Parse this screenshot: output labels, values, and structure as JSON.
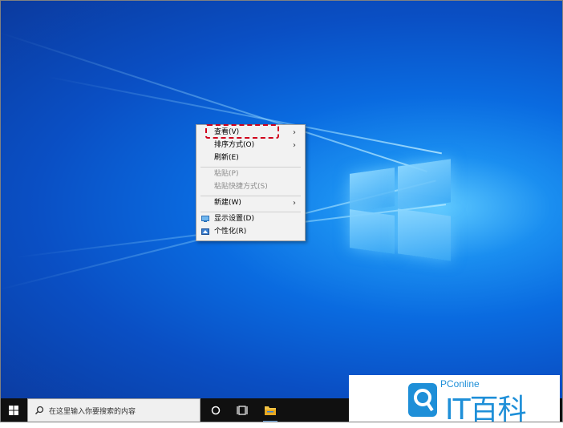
{
  "context_menu": {
    "items": [
      {
        "label": "查看(V)",
        "submenu": true
      },
      {
        "label": "排序方式(O)",
        "submenu": true
      },
      {
        "label": "刷新(E)"
      },
      {
        "label": "粘贴(P)",
        "disabled": true
      },
      {
        "label": "粘贴快捷方式(S)",
        "disabled": true
      },
      {
        "label": "新建(W)",
        "submenu": true
      },
      {
        "label": "显示设置(D)",
        "icon": "display-settings-icon"
      },
      {
        "label": "个性化(R)",
        "icon": "personalize-icon"
      }
    ]
  },
  "taskbar": {
    "search_placeholder": "在这里输入你要搜索的内容",
    "icons": [
      "windows-start-icon",
      "search-icon",
      "cortana-circle-icon",
      "task-view-icon",
      "file-explorer-icon"
    ]
  },
  "watermark": {
    "brand": "PConline",
    "name": "IT百科"
  },
  "colors": {
    "desktop_blue": "#0a6be0",
    "highlight_dashed": "#d0001b",
    "brand_blue": "#1e8fd8"
  }
}
